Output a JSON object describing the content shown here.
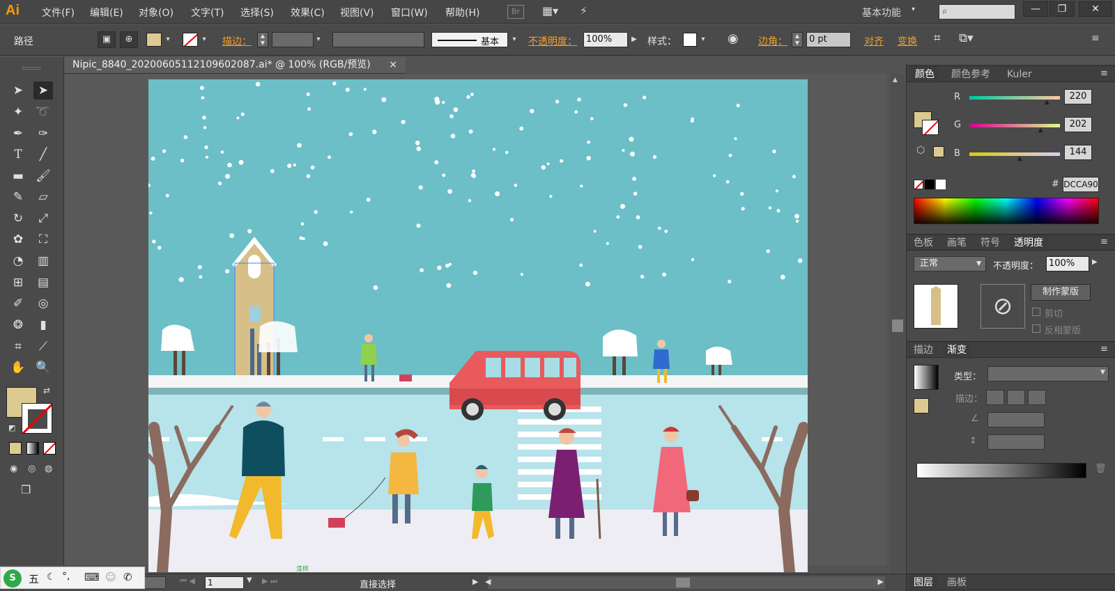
{
  "app": {
    "logo": "Ai",
    "workspace": "基本功能"
  },
  "menu": [
    "文件(F)",
    "编辑(E)",
    "对象(O)",
    "文字(T)",
    "选择(S)",
    "效果(C)",
    "视图(V)",
    "窗口(W)",
    "帮助(H)"
  ],
  "menu_extra": {
    "br": "Br"
  },
  "window_buttons": [
    "—",
    "❐",
    "✕"
  ],
  "control": {
    "selection_type": "路径",
    "stroke_label": "描边：",
    "stroke_style": "基本",
    "opacity_label": "不透明度：",
    "opacity_value": "100%",
    "style_label": "样式：",
    "corner_label": "边角：",
    "corner_value": "0 pt",
    "align_label": "对齐",
    "transform_label": "变换"
  },
  "document": {
    "tab_title": "Nipic_8840_20200605112109602087.ai* @ 100% (RGB/预览)",
    "close": "×"
  },
  "colors": {
    "fill": "#DCCA90",
    "stroke": "none",
    "bg": "#535353",
    "accent": "#f0a030"
  },
  "color_panel": {
    "tabs": [
      "颜色",
      "颜色参考",
      "Kuler"
    ],
    "r_label": "R",
    "g_label": "G",
    "b_label": "B",
    "r": "220",
    "g": "202",
    "b": "144",
    "r_pct": 0.86,
    "g_pct": 0.79,
    "b_pct": 0.56,
    "hex_label": "#",
    "hex": "DCCA90"
  },
  "transparency_panel": {
    "tabs": [
      "色板",
      "画笔",
      "符号",
      "透明度"
    ],
    "blend_mode": "正常",
    "opacity_label": "不透明度：",
    "opacity_value": "100%",
    "make_mask": "制作蒙版",
    "clip": "剪切",
    "invert_mask": "反相蒙版"
  },
  "gradient_panel": {
    "tabs": [
      "描边",
      "渐变"
    ],
    "type_label": "类型：",
    "stroke_label": "描边："
  },
  "layers_tabs": [
    "图层",
    "画板"
  ],
  "status": {
    "zoom": "100%",
    "page": "1",
    "tool": "直接选择"
  },
  "ime": {
    "logo": "S",
    "mode": "五"
  },
  "artwork": {
    "snow_label": "漆样"
  }
}
